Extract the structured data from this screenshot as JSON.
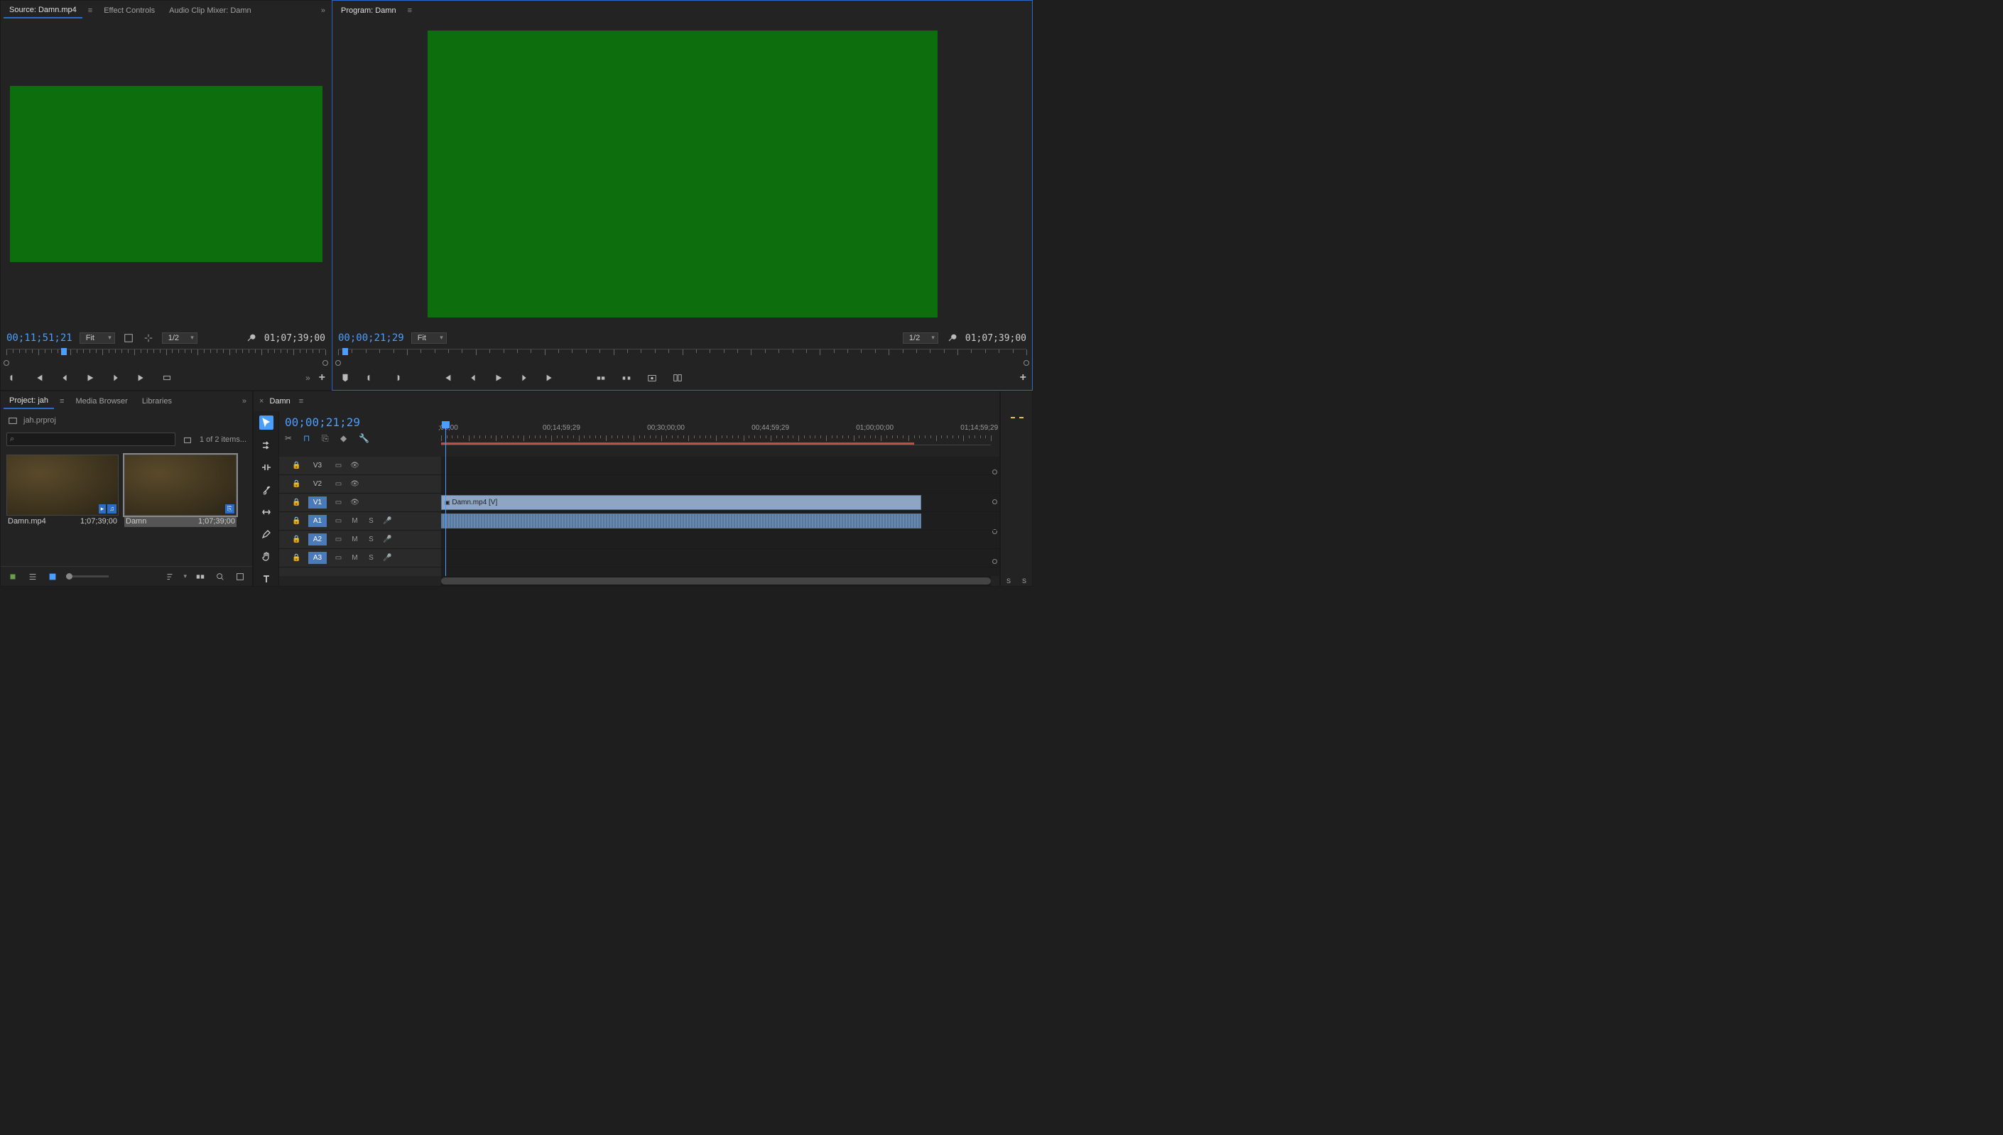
{
  "source": {
    "tabs": [
      "Source: Damn.mp4",
      "Effect Controls",
      "Audio Clip Mixer: Damn"
    ],
    "active_tab": 0,
    "timecode": "00;11;51;21",
    "zoom": "Fit",
    "res": "1/2",
    "duration": "01;07;39;00",
    "playhead_pct": 18
  },
  "program": {
    "tab": "Program: Damn",
    "timecode": "00;00;21;29",
    "zoom": "Fit",
    "res": "1/2",
    "duration": "01;07;39;00",
    "playhead_pct": 1
  },
  "project": {
    "tabs": [
      "Project: jah",
      "Media Browser",
      "Libraries"
    ],
    "active_tab": 0,
    "filename": "jah.prproj",
    "search_placeholder": "",
    "item_count": "1 of 2 items...",
    "items": [
      {
        "name": "Damn.mp4",
        "duration": "1;07;39;00",
        "selected": false,
        "badge": "av"
      },
      {
        "name": "Damn",
        "duration": "1;07;39;00",
        "selected": true,
        "badge": "seq"
      }
    ]
  },
  "timeline": {
    "tab": "Damn",
    "timecode": "00;00;21;29",
    "ruler_labels": [
      {
        "t": ";00;00",
        "pct": 0
      },
      {
        "t": "00;14;59;29",
        "pct": 19
      },
      {
        "t": "00;30;00;00",
        "pct": 38
      },
      {
        "t": "00;44;59;29",
        "pct": 57
      },
      {
        "t": "01;00;00;00",
        "pct": 76
      },
      {
        "t": "01;14;59;29",
        "pct": 95
      }
    ],
    "work_area_pct": [
      0,
      86
    ],
    "playhead_pct": 0.7,
    "tracks": {
      "video": [
        {
          "id": "V3",
          "active": false
        },
        {
          "id": "V2",
          "active": false
        },
        {
          "id": "V1",
          "active": true
        }
      ],
      "audio": [
        {
          "id": "A1",
          "active": true
        },
        {
          "id": "A2",
          "active": true
        },
        {
          "id": "A3",
          "active": true
        }
      ]
    },
    "clips": [
      {
        "track": "V1",
        "label": "Damn.mp4 [V]",
        "start_pct": 0,
        "end_pct": 86,
        "kind": "video"
      },
      {
        "track": "A1",
        "label": "",
        "start_pct": 0,
        "end_pct": 86,
        "kind": "audio"
      }
    ]
  },
  "meters": {
    "labels": [
      "S",
      "S"
    ]
  },
  "icons": {
    "menu": "≡",
    "chevrons": "»",
    "wrench": "🔧",
    "plus": "+"
  }
}
